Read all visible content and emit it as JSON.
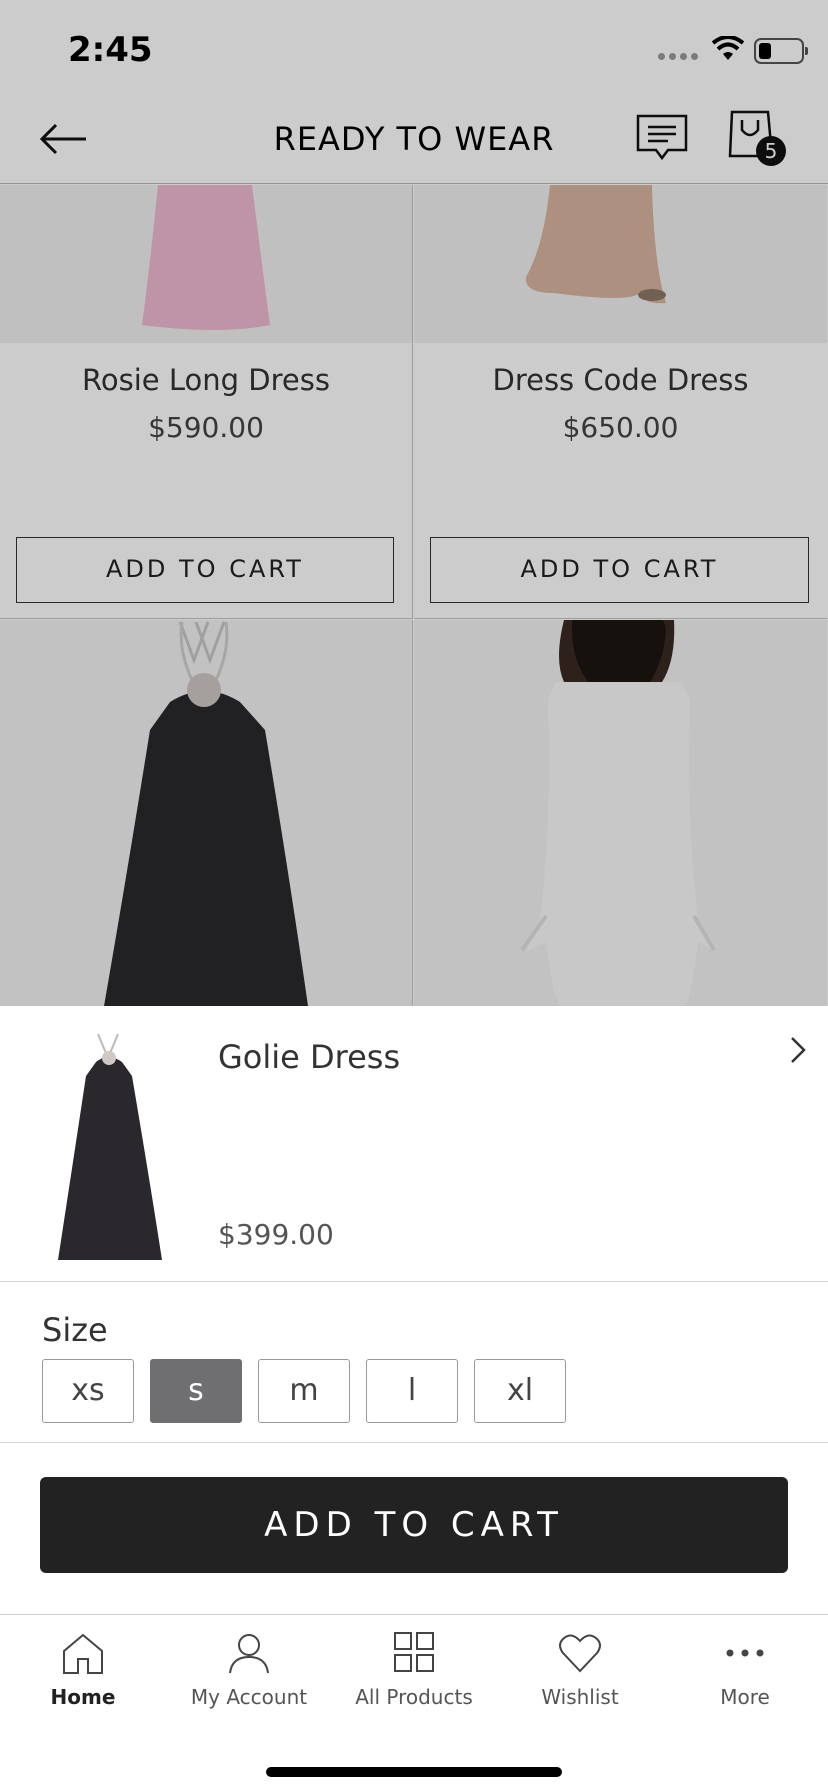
{
  "status_bar": {
    "time": "2:45"
  },
  "header": {
    "title": "READY TO WEAR",
    "cart_count": "5"
  },
  "products": [
    {
      "name": "Rosie Long Dress",
      "price": "$590.00",
      "button": "ADD TO CART",
      "image_color": "#f2c2d6"
    },
    {
      "name": "Dress Code Dress",
      "price": "$650.00",
      "button": "ADD TO CART",
      "image_color": "#d9b7a4"
    }
  ],
  "sheet": {
    "product_name": "Golie Dress",
    "price": "$399.00",
    "size_label": "Size",
    "sizes": [
      "xs",
      "s",
      "m",
      "l",
      "xl"
    ],
    "selected_size": "s",
    "add_to_cart": "ADD TO CART"
  },
  "tabs": [
    {
      "label": "Home",
      "icon": "home-icon",
      "active": true
    },
    {
      "label": "My Account",
      "icon": "user-icon",
      "active": false
    },
    {
      "label": "All Products",
      "icon": "grid-icon",
      "active": false
    },
    {
      "label": "Wishlist",
      "icon": "heart-icon",
      "active": false
    },
    {
      "label": "More",
      "icon": "more-icon",
      "active": false
    }
  ]
}
